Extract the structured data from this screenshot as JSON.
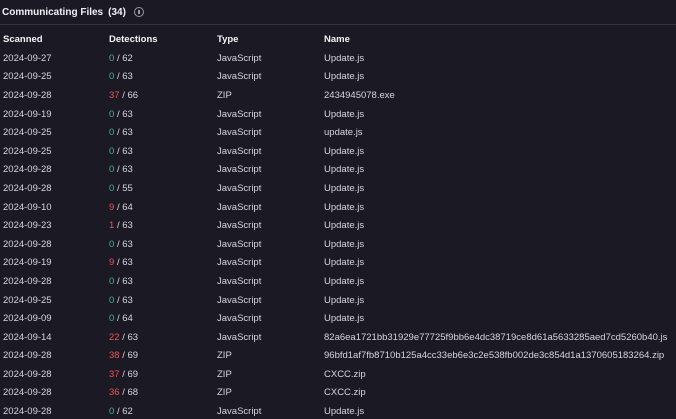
{
  "header": {
    "title": "Communicating Files",
    "count": "(34)"
  },
  "columns": {
    "scanned": "Scanned",
    "detections": "Detections",
    "type": "Type",
    "name": "Name"
  },
  "rows": [
    {
      "scanned": "2024-09-27",
      "det": "0",
      "total": "/ 62",
      "type": "JavaScript",
      "name": "Update.js"
    },
    {
      "scanned": "2024-09-25",
      "det": "0",
      "total": "/ 63",
      "type": "JavaScript",
      "name": "Update.js"
    },
    {
      "scanned": "2024-09-28",
      "det": "37",
      "total": "/ 66",
      "type": "ZIP",
      "name": "2434945078.exe"
    },
    {
      "scanned": "2024-09-19",
      "det": "0",
      "total": "/ 63",
      "type": "JavaScript",
      "name": "Update.js"
    },
    {
      "scanned": "2024-09-25",
      "det": "0",
      "total": "/ 63",
      "type": "JavaScript",
      "name": "update.js"
    },
    {
      "scanned": "2024-09-25",
      "det": "0",
      "total": "/ 63",
      "type": "JavaScript",
      "name": "Update.js"
    },
    {
      "scanned": "2024-09-28",
      "det": "0",
      "total": "/ 63",
      "type": "JavaScript",
      "name": "Update.js"
    },
    {
      "scanned": "2024-09-28",
      "det": "0",
      "total": "/ 55",
      "type": "JavaScript",
      "name": "Update.js"
    },
    {
      "scanned": "2024-09-10",
      "det": "9",
      "total": "/ 64",
      "type": "JavaScript",
      "name": "Update.js"
    },
    {
      "scanned": "2024-09-23",
      "det": "1",
      "total": "/ 63",
      "type": "JavaScript",
      "name": "Update.js"
    },
    {
      "scanned": "2024-09-28",
      "det": "0",
      "total": "/ 63",
      "type": "JavaScript",
      "name": "Update.js"
    },
    {
      "scanned": "2024-09-19",
      "det": "9",
      "total": "/ 63",
      "type": "JavaScript",
      "name": "Update.js"
    },
    {
      "scanned": "2024-09-28",
      "det": "0",
      "total": "/ 63",
      "type": "JavaScript",
      "name": "Update.js"
    },
    {
      "scanned": "2024-09-25",
      "det": "0",
      "total": "/ 63",
      "type": "JavaScript",
      "name": "Update.js"
    },
    {
      "scanned": "2024-09-09",
      "det": "0",
      "total": "/ 64",
      "type": "JavaScript",
      "name": "Update.js"
    },
    {
      "scanned": "2024-09-14",
      "det": "22",
      "total": "/ 63",
      "type": "JavaScript",
      "name": "82a6ea1721bb31929e77725f9bb6e4dc38719ce8d61a5633285aed7cd5260b40.js"
    },
    {
      "scanned": "2024-09-28",
      "det": "38",
      "total": "/ 69",
      "type": "ZIP",
      "name": "96bfd1af7fb8710b125a4cc33eb6e3c2e538fb002de3c854d1a1370605183264.zip"
    },
    {
      "scanned": "2024-09-28",
      "det": "37",
      "total": "/ 69",
      "type": "ZIP",
      "name": "CXCC.zip"
    },
    {
      "scanned": "2024-09-28",
      "det": "36",
      "total": "/ 68",
      "type": "ZIP",
      "name": "CXCC.zip"
    },
    {
      "scanned": "2024-09-28",
      "det": "0",
      "total": "/ 62",
      "type": "JavaScript",
      "name": "Update.js"
    }
  ],
  "colors": {
    "positive": "#f05252",
    "zero": "#3dbd7d"
  }
}
